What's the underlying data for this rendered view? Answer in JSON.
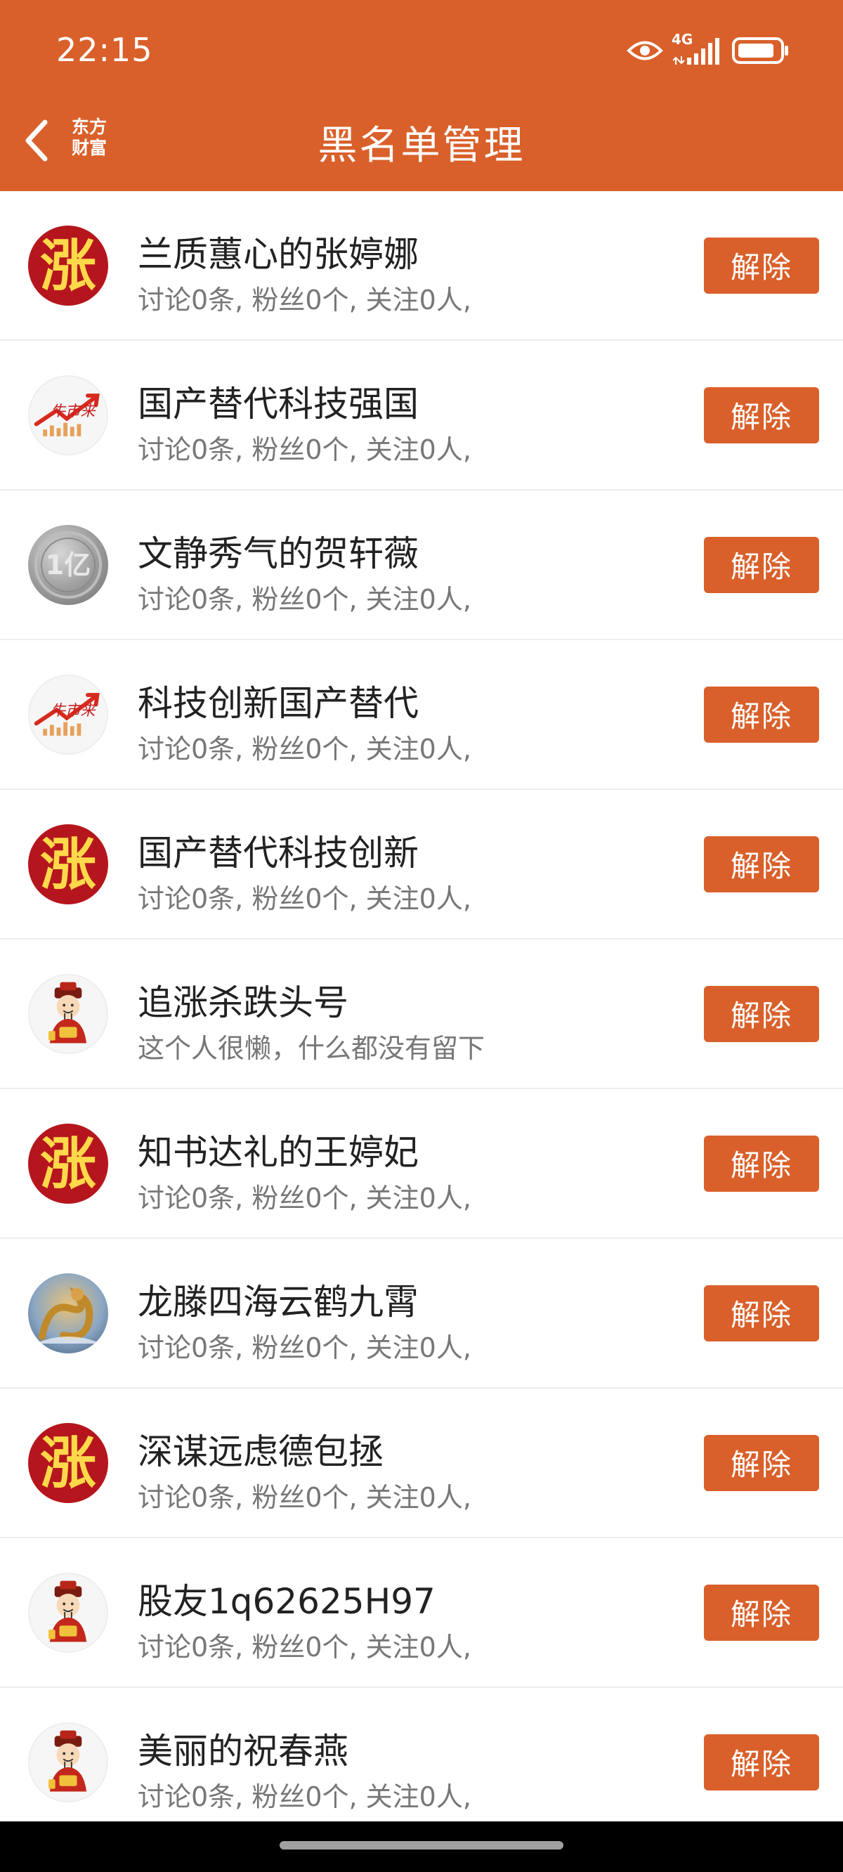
{
  "status_bar": {
    "time": "22:15",
    "network": "4G"
  },
  "header": {
    "brand_line1": "东方",
    "brand_line2": "财富",
    "title": "黑名单管理"
  },
  "colors": {
    "accent": "#d9602a",
    "zhang_avatar_bg": "#b5161d",
    "zhang_avatar_text": "#ffd94a"
  },
  "remove_label": "解除",
  "users": [
    {
      "name": "兰质蕙心的张婷娜",
      "desc": "讨论0条, 粉丝0个, 关注0人,",
      "avatar": "zhang-avatar",
      "avatar_text": "涨"
    },
    {
      "name": "国产替代科技强国",
      "desc": "讨论0条, 粉丝0个, 关注0人,",
      "avatar": "bull-market-avatar",
      "avatar_text": "牛市来"
    },
    {
      "name": "文静秀气的贺轩薇",
      "desc": "讨论0条, 粉丝0个, 关注0人,",
      "avatar": "coin-avatar",
      "avatar_text": "1亿"
    },
    {
      "name": "科技创新国产替代",
      "desc": "讨论0条, 粉丝0个, 关注0人,",
      "avatar": "bull-market-avatar",
      "avatar_text": "牛市来"
    },
    {
      "name": "国产替代科技创新",
      "desc": "讨论0条, 粉丝0个, 关注0人,",
      "avatar": "zhang-avatar",
      "avatar_text": "涨"
    },
    {
      "name": "追涨杀跌头号",
      "desc": "这个人很懒，什么都没有留下",
      "avatar": "fortune-god-avatar",
      "avatar_text": ""
    },
    {
      "name": "知书达礼的王婷妃",
      "desc": "讨论0条, 粉丝0个, 关注0人,",
      "avatar": "zhang-avatar",
      "avatar_text": "涨"
    },
    {
      "name": "龙滕四海云鹤九霄",
      "desc": "讨论0条, 粉丝0个, 关注0人,",
      "avatar": "dragon-avatar",
      "avatar_text": ""
    },
    {
      "name": "深谋远虑德包拯",
      "desc": "讨论0条, 粉丝0个, 关注0人,",
      "avatar": "zhang-avatar",
      "avatar_text": "涨"
    },
    {
      "name": "股友1q62625H97",
      "desc": "讨论0条, 粉丝0个, 关注0人,",
      "avatar": "fortune-god-avatar",
      "avatar_text": ""
    },
    {
      "name": "美丽的祝春燕",
      "desc": "讨论0条, 粉丝0个, 关注0人,",
      "avatar": "fortune-god-avatar",
      "avatar_text": ""
    }
  ]
}
